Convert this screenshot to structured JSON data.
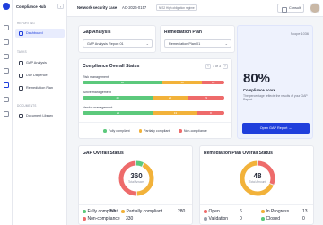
{
  "app": {
    "name": "Compliance Hub",
    "collapse_icon": "chevron-left-icon"
  },
  "sidebar": {
    "section_reporting": "REPORTING",
    "section_tasks": "TASKS",
    "section_documents": "DOCUMENTS",
    "items": [
      {
        "label": "Dashboard",
        "icon": "grid-icon"
      },
      {
        "label": "GAP Analysis",
        "icon": "chart-icon"
      },
      {
        "label": "Due Diligence",
        "icon": "check-icon"
      },
      {
        "label": "Remediation Plan",
        "icon": "clipboard-icon"
      },
      {
        "label": "Document Library",
        "icon": "folder-icon"
      }
    ]
  },
  "topbar": {
    "case_label": "Network security case",
    "case_id": "AC-2026-0157",
    "tag": "NIS2 High obligation regime",
    "consult_label": "Consult"
  },
  "gap_card": {
    "title": "Gap Analysis",
    "dropdown_value": "GAP Analysis Report 01"
  },
  "remediation_card": {
    "title": "Remediation Plan",
    "dropdown_value": "Remediation Plan 01"
  },
  "scope_card": {
    "badge": "Scope 1036",
    "percent": "80%",
    "label": "Compliance score",
    "description": "The percentage reflects the results of your GAP Report",
    "button": "Open GAP Report →"
  },
  "compliance_status": {
    "title": "Compliance Overall Status",
    "pager": "1 of 3",
    "rows": [
      {
        "label": "Risk management",
        "values": [
          36,
          18,
          10
        ]
      },
      {
        "label": "Active management",
        "values": [
          40,
          20,
          21
        ]
      },
      {
        "label": "Vendor management",
        "values": [
          21,
          13,
          8
        ]
      }
    ],
    "legend": [
      "Fully compliant",
      "Partially compliant",
      "Non-compliance"
    ]
  },
  "colors": {
    "green": "#5cc97c",
    "orange": "#f2b23a",
    "red": "#ee6b6b",
    "accent": "#1f3fdc"
  },
  "gap_status": {
    "title": "GAP Overall Status",
    "total": "360",
    "total_label": "Total Answer",
    "stats": [
      {
        "label": "Fully compliant",
        "value": "50",
        "color": "green"
      },
      {
        "label": "Partially compliant",
        "value": "280",
        "color": "orange"
      },
      {
        "label": "Non-compliance",
        "value": "330",
        "color": "red"
      }
    ]
  },
  "remediation_status": {
    "title": "Remediation Plan Overall Status",
    "total": "48",
    "total_label": "Total Amount",
    "stats": [
      {
        "label": "Open",
        "value": "6",
        "color": "red"
      },
      {
        "label": "In Progress",
        "value": "13",
        "color": "orange"
      },
      {
        "label": "Validation",
        "value": "0",
        "color": "gray"
      },
      {
        "label": "Closed",
        "value": "0",
        "color": "green"
      }
    ]
  }
}
